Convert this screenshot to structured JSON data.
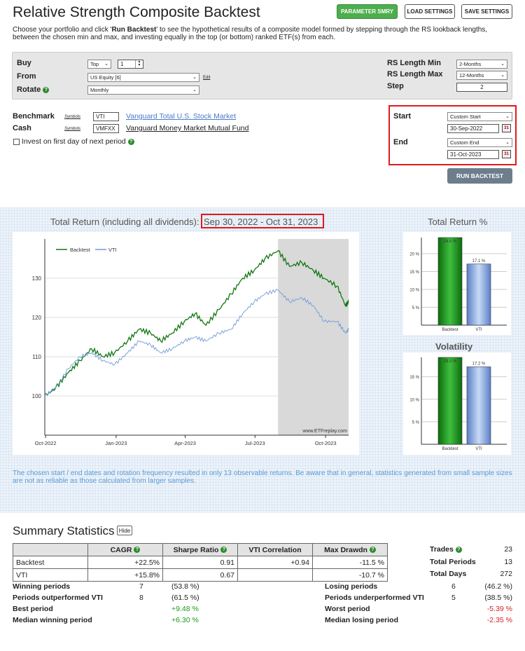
{
  "header": {
    "title": "Relative Strength Composite Backtest",
    "btn_param": "PARAMETER SMRY",
    "btn_load": "LOAD SETTINGS",
    "btn_save": "SAVE SETTINGS"
  },
  "intro": {
    "pre": "Choose your portfolio and click '",
    "bold": "Run Backtest",
    "post": "' to see the hypothetical results of a composite model formed by stepping through the RS lookback lengths, between the chosen min and max, and investing equally in the top (or bottom) ranked ETF(s) from each."
  },
  "settings": {
    "buy_label": "Buy",
    "buy_value": "Top",
    "buy_count": "1",
    "from_label": "From",
    "from_value": "US Equity [6]",
    "edit": "Edit",
    "rotate_label": "Rotate",
    "rotate_value": "Monthly",
    "rs_min_label": "RS Length Min",
    "rs_min_value": "2-Months",
    "rs_max_label": "RS Length Max",
    "rs_max_value": "12-Months",
    "step_label": "Step",
    "step_value": "2"
  },
  "bench": {
    "benchmark_label": "Benchmark",
    "symbols": "Symbols",
    "benchmark_sym": "VTI",
    "benchmark_name": "Vanguard Total U.S. Stock Market",
    "cash_label": "Cash",
    "cash_sym": "VMFXX",
    "cash_name": "Vanguard Money Market Mutual Fund",
    "invest_label": "Invest on first day of next period"
  },
  "dates": {
    "start_label": "Start",
    "start_mode": "Custom Start",
    "start_date": "30-Sep-2022",
    "end_label": "End",
    "end_mode": "Custom End",
    "end_date": "31-Oct-2023",
    "cal_icon": "31",
    "run": "RUN BACKTEST"
  },
  "chart_main": {
    "title_pre": "Total Return (including all dividends):",
    "title_range": "Sep 30, 2022 - Oct 31, 2023",
    "watermark": "www.ETFreplay.com"
  },
  "chart_data": [
    {
      "type": "line",
      "title": "Total Return (including all dividends): Sep 30, 2022 - Oct 31, 2023",
      "ylim": [
        90,
        140
      ],
      "y_ticks": [
        "100",
        "110",
        "120",
        "130"
      ],
      "x_ticks": [
        "Oct-2022",
        "Jan-2023",
        "Apr-2023",
        "Jul-2023",
        "Oct-2023"
      ],
      "shaded_region": [
        "2023-07-31",
        "2023-10-31"
      ],
      "legend": "top-left",
      "grid": true,
      "series": [
        {
          "name": "Backtest",
          "color": "#117711",
          "x": [
            "2022-09-30",
            "2022-10-14",
            "2022-10-31",
            "2022-11-15",
            "2022-11-30",
            "2022-12-15",
            "2022-12-30",
            "2023-01-16",
            "2023-01-31",
            "2023-02-15",
            "2023-02-28",
            "2023-03-15",
            "2023-03-31",
            "2023-04-14",
            "2023-04-28",
            "2023-05-15",
            "2023-05-31",
            "2023-06-15",
            "2023-06-30",
            "2023-07-14",
            "2023-07-31",
            "2023-08-15",
            "2023-08-31",
            "2023-09-15",
            "2023-09-29",
            "2023-10-16",
            "2023-10-27",
            "2023-10-31"
          ],
          "values": [
            100,
            102,
            106,
            109,
            112,
            110,
            111,
            114,
            117,
            116,
            114,
            116,
            119,
            121,
            118,
            122,
            126,
            130,
            132,
            135,
            137,
            133,
            134,
            132,
            130,
            128,
            123,
            124
          ]
        },
        {
          "name": "VTI",
          "color": "#6f9ad8",
          "x": [
            "2022-09-30",
            "2022-10-14",
            "2022-10-31",
            "2022-11-15",
            "2022-11-30",
            "2022-12-15",
            "2022-12-30",
            "2023-01-16",
            "2023-01-31",
            "2023-02-15",
            "2023-02-28",
            "2023-03-15",
            "2023-03-31",
            "2023-04-14",
            "2023-04-28",
            "2023-05-15",
            "2023-05-31",
            "2023-06-15",
            "2023-06-30",
            "2023-07-14",
            "2023-07-31",
            "2023-08-15",
            "2023-08-31",
            "2023-09-15",
            "2023-09-29",
            "2023-10-16",
            "2023-10-27",
            "2023-10-31"
          ],
          "values": [
            100,
            102,
            107,
            110,
            111,
            109,
            108,
            111,
            114,
            113,
            111,
            112,
            114,
            115,
            114,
            116,
            117,
            121,
            124,
            126,
            127,
            124,
            125,
            123,
            119,
            119,
            116,
            117
          ]
        }
      ]
    },
    {
      "type": "bar",
      "title": "Total Return %",
      "categories": [
        "Backtest",
        "VTI"
      ],
      "values": [
        24.5,
        17.1
      ],
      "labels": [
        "24.5 %",
        "17.1 %"
      ],
      "y_ticks": [
        "5 %",
        "10 %",
        "15 %",
        "20 %"
      ],
      "ylim": [
        0,
        24.5
      ]
    },
    {
      "type": "bar",
      "title": "Volatility",
      "categories": [
        "Backtest",
        "VTI"
      ],
      "values": [
        19.3,
        17.2
      ],
      "labels": [
        "19.3 %",
        "17.2 %"
      ],
      "y_ticks": [
        "5 %",
        "10 %",
        "15 %"
      ],
      "ylim": [
        0,
        19.3
      ]
    }
  ],
  "note": "The chosen start / end dates and rotation frequency resulted in only 13 observable returns. Be aware that in general, statistics generated from small sample sizes are not as reliable as those calculated from larger samples.",
  "summary": {
    "title": "Summary Statistics",
    "hide": "Hide",
    "headers": [
      "CAGR",
      "Sharpe Ratio",
      "VTI Correlation",
      "Max Drawdn"
    ],
    "rows": [
      {
        "name": "Backtest",
        "cagr": "+22.5%",
        "sharpe": "0.91",
        "corr": "+0.94",
        "dd": "-11.5 %"
      },
      {
        "name": "VTI",
        "cagr": "+15.8%",
        "sharpe": "0.67",
        "corr": "",
        "dd": "-10.7 %"
      }
    ],
    "trades_label": "Trades",
    "trades": "23",
    "periods_label": "Total Periods",
    "periods": "13",
    "days_label": "Total Days",
    "days": "272",
    "left": [
      {
        "label": "Winning periods",
        "n": "7",
        "v": "(53.8 %)"
      },
      {
        "label": "Periods outperformed VTI",
        "n": "8",
        "v": "(61.5 %)"
      },
      {
        "label": "Best period",
        "n": "",
        "v": "+9.48 %"
      },
      {
        "label": "Median winning period",
        "n": "",
        "v": "+6.30 %"
      }
    ],
    "right": [
      {
        "label": "Losing periods",
        "n": "6",
        "v": "(46.2 %)"
      },
      {
        "label": "Periods underperformed VTI",
        "n": "5",
        "v": "(38.5 %)"
      },
      {
        "label": "Worst period",
        "n": "",
        "v": "-5.39 %"
      },
      {
        "label": "Median losing period",
        "n": "",
        "v": "-2.35 %"
      }
    ],
    "info_icon": "?"
  }
}
